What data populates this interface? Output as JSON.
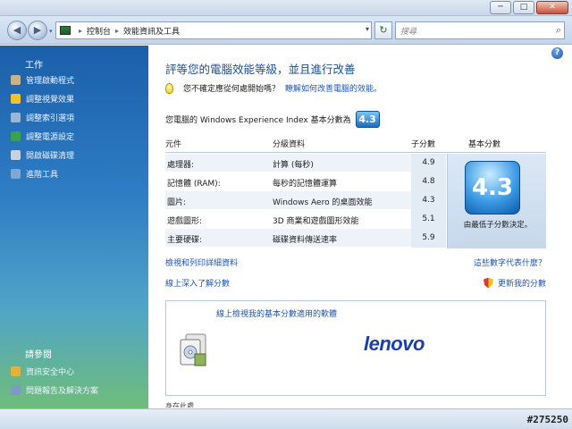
{
  "window": {
    "min_label": "─",
    "max_label": "□",
    "close_label": "✕"
  },
  "nav": {
    "back_glyph": "◀",
    "forward_glyph": "▶",
    "history_glyph": "▾",
    "breadcrumb": [
      "控制台",
      "效能資訊及工具"
    ],
    "breadcrumb_sep": "▸",
    "address_drop_glyph": "▾",
    "refresh_glyph": "↻",
    "search_placeholder": "搜尋",
    "search_glyph": "⌕"
  },
  "sidebar": {
    "tasks_title": "工作",
    "tasks": [
      {
        "label": "管理啟動程式",
        "icon": "startup-programs-icon",
        "color": "#c9b18a"
      },
      {
        "label": "調整視覺效果",
        "icon": "visual-effects-shield-icon",
        "color": "#f0c32a"
      },
      {
        "label": "調整索引選項",
        "icon": "indexing-options-icon",
        "color": "#9ab7d9"
      },
      {
        "label": "調整電源設定",
        "icon": "power-settings-icon",
        "color": "#3aa24a"
      },
      {
        "label": "開啟磁碟清理",
        "icon": "disk-cleanup-icon",
        "color": "#c7d3e2"
      },
      {
        "label": "進階工具",
        "icon": "advanced-tools-icon",
        "color": "#7fa7d6"
      }
    ],
    "see_also_title": "請參閱",
    "see_also": [
      {
        "label": "資訊安全中心",
        "icon": "security-center-icon",
        "color": "#e2b33a"
      },
      {
        "label": "問題報告及解決方案",
        "icon": "problem-reports-icon",
        "color": "#7d9ac0"
      }
    ]
  },
  "main": {
    "help_glyph": "?",
    "heading": "評等您的電腦效能等級，並且進行改善",
    "tip_text": "您不確定應從何處開始嗎？",
    "tip_link": "瞭解如何改善電腦的效能。",
    "score_label": "您電腦的 Windows Experience Index 基本分數為",
    "base_score": "4.3",
    "table": {
      "headers": [
        "元件",
        "分級資料",
        "子分數",
        "基本分數"
      ],
      "rows": [
        {
          "component": "處理器:",
          "details": "計算 (每秒)",
          "subscore": "4.9"
        },
        {
          "component": "記憶體 (RAM):",
          "details": "每秒的記憶體運算",
          "subscore": "4.8"
        },
        {
          "component": "圖片:",
          "details": "Windows Aero 的桌面效能",
          "subscore": "4.3"
        },
        {
          "component": "遊戲圖形:",
          "details": "3D 商業和遊戲圖形效能",
          "subscore": "5.1"
        },
        {
          "component": "主要硬碟:",
          "details": "磁碟資料傳送速率",
          "subscore": "5.9"
        }
      ],
      "base_caption": "由最低子分數決定。"
    },
    "links": {
      "print_details": "檢視和列印詳細資料",
      "what_means": "這些數字代表什麼？",
      "learn_online": "線上深入了解分數",
      "update_score": "更新我的分數"
    },
    "info_box": {
      "title": "線上檢視我的基本分數適用的軟體",
      "brand": "lenovo"
    },
    "clipped_text": "身在此處…"
  },
  "watermark": "#275250"
}
